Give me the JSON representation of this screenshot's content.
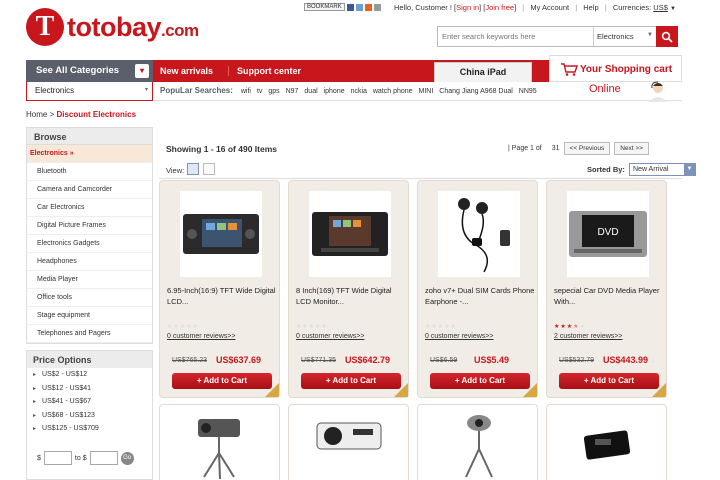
{
  "brand": {
    "initial": "T",
    "name": "totobay",
    "tld": ".com"
  },
  "share": {
    "bookmark": "BOOKMARK"
  },
  "topnav": {
    "greeting": "Hello, Customer ! [",
    "sign_in": "Sign in",
    "mid": "] [",
    "join": "Join free",
    "end": "]",
    "my_account": "My Account",
    "help": "Help",
    "currencies_label": "Currencies:",
    "currency": "US$"
  },
  "search": {
    "placeholder": "Enter search keywords here",
    "category": "Electronics"
  },
  "nav": {
    "categories_label": "See All Categories",
    "items": [
      "New arrivals",
      "Support center"
    ],
    "active": "China iPad",
    "cart": "Your Shopping cart"
  },
  "subbar": {
    "selected_category": "Electronics",
    "popular_label": "PopuLar Searches:",
    "popular": [
      "wifi",
      "tv",
      "gps",
      "N97",
      "dual",
      "iphone",
      "nckia",
      "watch phone",
      "MINI",
      "Chang Jiang A968 Dual",
      "NN95"
    ],
    "online": "Online"
  },
  "breadcrumb": {
    "home": "Home",
    "sep": " > ",
    "current": "Discount Electronics"
  },
  "sidebar": {
    "browse": "Browse",
    "active": "Electronics",
    "items": [
      "Bluetooth",
      "Camera and Camcorder",
      "Car Electronics",
      "Digital Picture Frames",
      "Electronics Gadgets",
      "Headphones",
      "Media Player",
      "Office tools",
      "Stage equipment",
      "Telephones and Pagers"
    ]
  },
  "price_options": {
    "title": "Price Options",
    "ranges": [
      "US$2 - US$12",
      "US$12 - US$41",
      "US$41 - US$67",
      "US$68 - US$123",
      "US$125 - US$709"
    ],
    "from": "$",
    "to": "to $",
    "go": "Go"
  },
  "listing": {
    "showing": "Showing 1 - 16 of 490 Items",
    "page_info": "| Page 1 of",
    "total_pages": "31",
    "prev": "<< Previous",
    "next": "Next >>",
    "view_label": "View:",
    "sorted_label": "Sorted By:",
    "sort_value": "New Arrival"
  },
  "products": [
    {
      "name": "6.95-Inch(16:9) TFT Wide Digital LCD...",
      "rating": 0,
      "reviews": "0 customer reviews>>",
      "old_price": "US$765.23",
      "price": "US$637.69",
      "cta": "Add to Cart"
    },
    {
      "name": "8 Inch(169) TFT Wide Digital LCD Monitor...",
      "rating": 0,
      "reviews": "0 customer reviews>>",
      "old_price": "US$771.35",
      "price": "US$642.79",
      "cta": "Add to Cart"
    },
    {
      "name": "zoho v7+ Dual SIM Cards Phone Earphone -...",
      "rating": 0,
      "reviews": "0 customer reviews>>",
      "old_price": "US$6.59",
      "price": "US$5.49",
      "cta": "Add to Cart"
    },
    {
      "name": "sepecial Car DVD Media Player With...",
      "rating": 3.5,
      "reviews": "2 customer reviews>>",
      "old_price": "US$532.79",
      "price": "US$443.99",
      "cta": "Add to Cart"
    }
  ],
  "dvd_label": "DVD",
  "colors": {
    "brand_red": "#c8161d",
    "nav_gray": "#5a5f6b",
    "card_bg": "#f1ede6"
  }
}
